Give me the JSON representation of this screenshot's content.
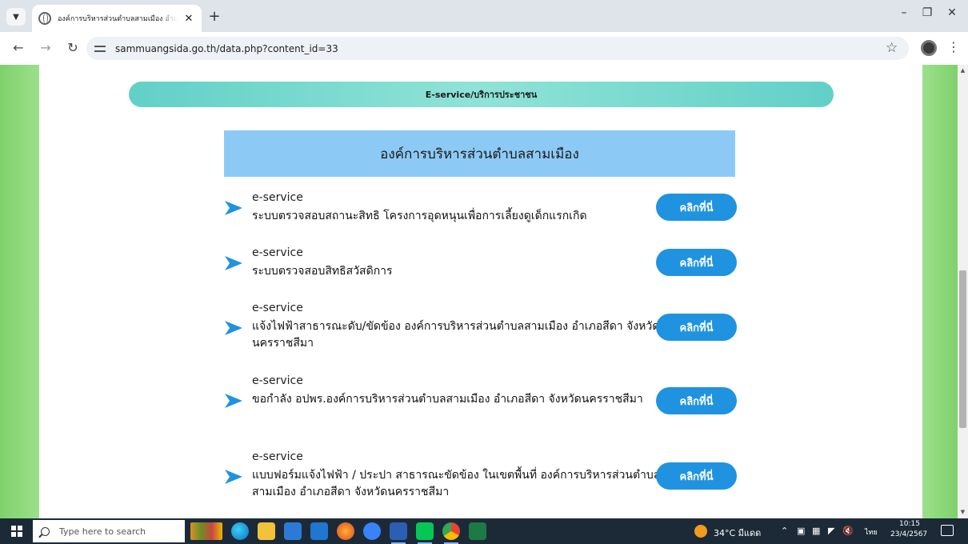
{
  "browser": {
    "tab_title": "องค์การบริหารส่วนตำบลสามเมือง อำเภ",
    "tab_close": "✕",
    "new_tab": "+",
    "url": "sammuangsida.go.th/data.php?content_id=33",
    "icons": [
      "tab-list-icon",
      "globe-favicon-icon",
      "back-icon",
      "forward-icon",
      "reload-icon",
      "site-info-icon",
      "bookmark-star-icon",
      "profile-icon",
      "menu-icon"
    ]
  },
  "page": {
    "section_title": "E-service/บริการประชาชน",
    "org_title": "องค์การบริหารส่วนตำบลสามเมือง",
    "services": [
      {
        "kind": "e-service",
        "title": "ระบบตรวจสอบสถานะสิทธิ โครงการอุดหนุนเพื่อการเลี้ยงดูเด็กแรกเกิด",
        "button": "คลิกที่นี่"
      },
      {
        "kind": "e-service",
        "title": "ระบบตรวจสอบสิทธิสวัสดิการ",
        "button": "คลิกที่นี่"
      },
      {
        "kind": "e-service",
        "title": "แจ้งไฟฟ้าสาธารณะดับ/ขัดข้อง องค์การบริหารส่วนตำบลสามเมือง อำเภอสีดา จังหวัดนครราชสีมา",
        "button": "คลิกที่นี่"
      },
      {
        "kind": "e-service",
        "title": "ขอกำลัง อปพร.องค์การบริหารส่วนตำบลสามเมือง อำเภอสีดา จังหวัดนครราชสีมา",
        "button": "คลิกที่นี่"
      },
      {
        "kind": "e-service",
        "title": "แบบฟอร์มแจ้งไฟฟ้า / ประปา สาธารณะขัดข้อง ในเขตพื้นที่ องค์การบริหารส่วนตำบลสามเมือง อำเภอสีดา จังหวัดนครราชสีมา",
        "button": "คลิกที่นี่"
      }
    ],
    "colors": {
      "accent_button": "#1f93e0",
      "arrow": "#1f93e0",
      "header_bg": "#8ccaf5",
      "pill": "#7ad9ce",
      "side": "#8ed67a"
    }
  },
  "taskbar": {
    "search_placeholder": "Type here to search",
    "weather": "34°C มีแดด",
    "lang": "ไทย",
    "time": "10:15",
    "date": "23/4/2567",
    "apps": [
      "file-explorer-icon",
      "edge-icon",
      "explorer-folder-icon",
      "store-icon",
      "mail-icon",
      "firefox-icon",
      "copilot-icon",
      "word-icon",
      "line-icon",
      "chrome-icon",
      "excel-icon"
    ]
  }
}
